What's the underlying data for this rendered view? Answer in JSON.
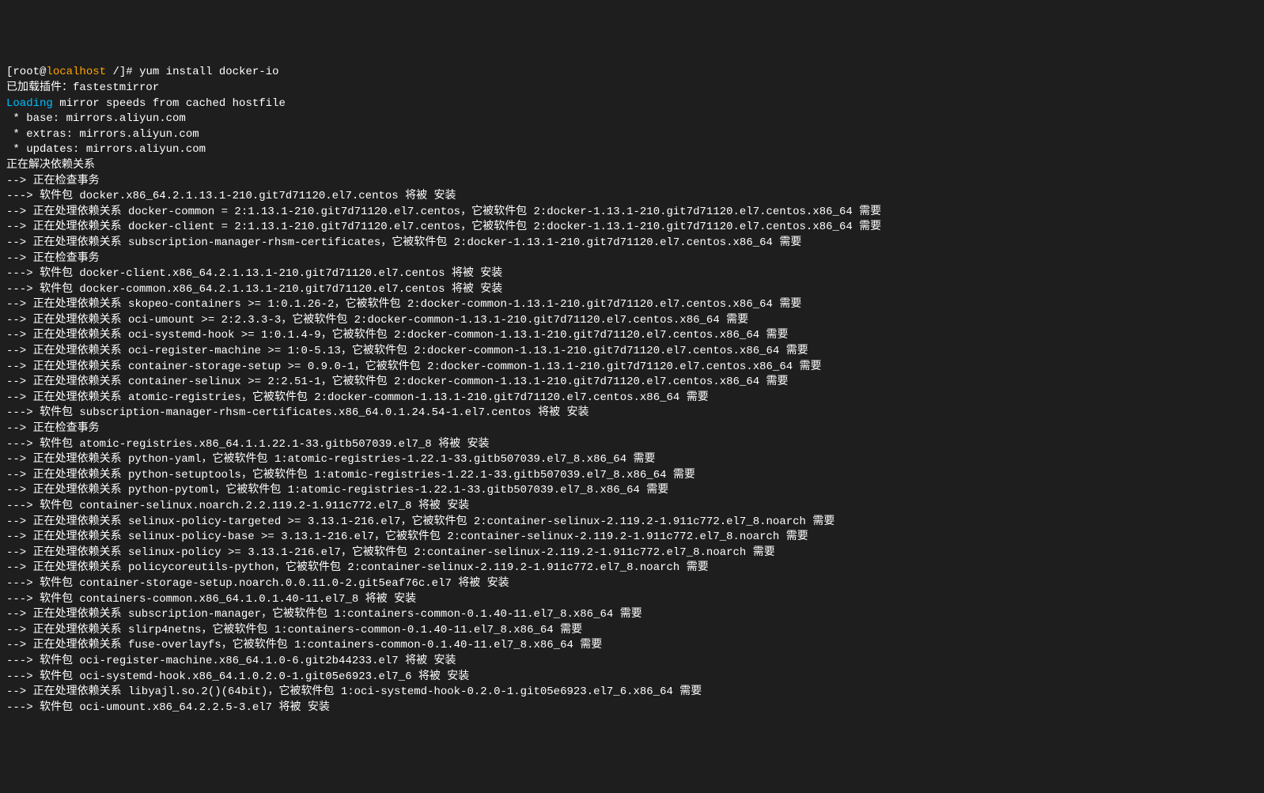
{
  "prompt": {
    "prefix": "[root@",
    "host": "localhost",
    "suffix": " /]# ",
    "command": "yum install docker-io"
  },
  "lines": [
    {
      "text": "已加载插件：fastestmirror",
      "class": "white"
    },
    {
      "segments": [
        {
          "text": "Loading",
          "class": "cyan"
        },
        {
          "text": " mirror speeds from cached hostfile",
          "class": "white"
        }
      ]
    },
    {
      "text": " * base: mirrors.aliyun.com",
      "class": "white"
    },
    {
      "text": " * extras: mirrors.aliyun.com",
      "class": "white"
    },
    {
      "text": " * updates: mirrors.aliyun.com",
      "class": "white"
    },
    {
      "text": "正在解决依赖关系",
      "class": "white"
    },
    {
      "text": "--> 正在检查事务",
      "class": "white"
    },
    {
      "text": "---> 软件包 docker.x86_64.2.1.13.1-210.git7d71120.el7.centos 将被 安装",
      "class": "white"
    },
    {
      "text": "--> 正在处理依赖关系 docker-common = 2:1.13.1-210.git7d71120.el7.centos，它被软件包 2:docker-1.13.1-210.git7d71120.el7.centos.x86_64 需要",
      "class": "white"
    },
    {
      "text": "--> 正在处理依赖关系 docker-client = 2:1.13.1-210.git7d71120.el7.centos，它被软件包 2:docker-1.13.1-210.git7d71120.el7.centos.x86_64 需要",
      "class": "white"
    },
    {
      "text": "--> 正在处理依赖关系 subscription-manager-rhsm-certificates，它被软件包 2:docker-1.13.1-210.git7d71120.el7.centos.x86_64 需要",
      "class": "white"
    },
    {
      "text": "--> 正在检查事务",
      "class": "white"
    },
    {
      "text": "---> 软件包 docker-client.x86_64.2.1.13.1-210.git7d71120.el7.centos 将被 安装",
      "class": "white"
    },
    {
      "text": "---> 软件包 docker-common.x86_64.2.1.13.1-210.git7d71120.el7.centos 将被 安装",
      "class": "white"
    },
    {
      "text": "--> 正在处理依赖关系 skopeo-containers >= 1:0.1.26-2，它被软件包 2:docker-common-1.13.1-210.git7d71120.el7.centos.x86_64 需要",
      "class": "white"
    },
    {
      "text": "--> 正在处理依赖关系 oci-umount >= 2:2.3.3-3，它被软件包 2:docker-common-1.13.1-210.git7d71120.el7.centos.x86_64 需要",
      "class": "white"
    },
    {
      "text": "--> 正在处理依赖关系 oci-systemd-hook >= 1:0.1.4-9，它被软件包 2:docker-common-1.13.1-210.git7d71120.el7.centos.x86_64 需要",
      "class": "white"
    },
    {
      "text": "--> 正在处理依赖关系 oci-register-machine >= 1:0-5.13，它被软件包 2:docker-common-1.13.1-210.git7d71120.el7.centos.x86_64 需要",
      "class": "white"
    },
    {
      "text": "--> 正在处理依赖关系 container-storage-setup >= 0.9.0-1，它被软件包 2:docker-common-1.13.1-210.git7d71120.el7.centos.x86_64 需要",
      "class": "white"
    },
    {
      "text": "--> 正在处理依赖关系 container-selinux >= 2:2.51-1，它被软件包 2:docker-common-1.13.1-210.git7d71120.el7.centos.x86_64 需要",
      "class": "white"
    },
    {
      "text": "--> 正在处理依赖关系 atomic-registries，它被软件包 2:docker-common-1.13.1-210.git7d71120.el7.centos.x86_64 需要",
      "class": "white"
    },
    {
      "text": "---> 软件包 subscription-manager-rhsm-certificates.x86_64.0.1.24.54-1.el7.centos 将被 安装",
      "class": "white"
    },
    {
      "text": "--> 正在检查事务",
      "class": "white"
    },
    {
      "text": "---> 软件包 atomic-registries.x86_64.1.1.22.1-33.gitb507039.el7_8 将被 安装",
      "class": "white"
    },
    {
      "text": "--> 正在处理依赖关系 python-yaml，它被软件包 1:atomic-registries-1.22.1-33.gitb507039.el7_8.x86_64 需要",
      "class": "white"
    },
    {
      "text": "--> 正在处理依赖关系 python-setuptools，它被软件包 1:atomic-registries-1.22.1-33.gitb507039.el7_8.x86_64 需要",
      "class": "white"
    },
    {
      "text": "--> 正在处理依赖关系 python-pytoml，它被软件包 1:atomic-registries-1.22.1-33.gitb507039.el7_8.x86_64 需要",
      "class": "white"
    },
    {
      "text": "---> 软件包 container-selinux.noarch.2.2.119.2-1.911c772.el7_8 将被 安装",
      "class": "white"
    },
    {
      "text": "--> 正在处理依赖关系 selinux-policy-targeted >= 3.13.1-216.el7，它被软件包 2:container-selinux-2.119.2-1.911c772.el7_8.noarch 需要",
      "class": "white"
    },
    {
      "text": "--> 正在处理依赖关系 selinux-policy-base >= 3.13.1-216.el7，它被软件包 2:container-selinux-2.119.2-1.911c772.el7_8.noarch 需要",
      "class": "white"
    },
    {
      "text": "--> 正在处理依赖关系 selinux-policy >= 3.13.1-216.el7，它被软件包 2:container-selinux-2.119.2-1.911c772.el7_8.noarch 需要",
      "class": "white"
    },
    {
      "text": "--> 正在处理依赖关系 policycoreutils-python，它被软件包 2:container-selinux-2.119.2-1.911c772.el7_8.noarch 需要",
      "class": "white"
    },
    {
      "text": "---> 软件包 container-storage-setup.noarch.0.0.11.0-2.git5eaf76c.el7 将被 安装",
      "class": "white"
    },
    {
      "text": "---> 软件包 containers-common.x86_64.1.0.1.40-11.el7_8 将被 安装",
      "class": "white"
    },
    {
      "text": "--> 正在处理依赖关系 subscription-manager，它被软件包 1:containers-common-0.1.40-11.el7_8.x86_64 需要",
      "class": "white"
    },
    {
      "text": "--> 正在处理依赖关系 slirp4netns，它被软件包 1:containers-common-0.1.40-11.el7_8.x86_64 需要",
      "class": "white"
    },
    {
      "text": "--> 正在处理依赖关系 fuse-overlayfs，它被软件包 1:containers-common-0.1.40-11.el7_8.x86_64 需要",
      "class": "white"
    },
    {
      "text": "---> 软件包 oci-register-machine.x86_64.1.0-6.git2b44233.el7 将被 安装",
      "class": "white"
    },
    {
      "text": "---> 软件包 oci-systemd-hook.x86_64.1.0.2.0-1.git05e6923.el7_6 将被 安装",
      "class": "white"
    },
    {
      "text": "--> 正在处理依赖关系 libyajl.so.2()(64bit)，它被软件包 1:oci-systemd-hook-0.2.0-1.git05e6923.el7_6.x86_64 需要",
      "class": "white"
    },
    {
      "text": "---> 软件包 oci-umount.x86_64.2.2.5-3.el7 将被 安装",
      "class": "white"
    }
  ]
}
